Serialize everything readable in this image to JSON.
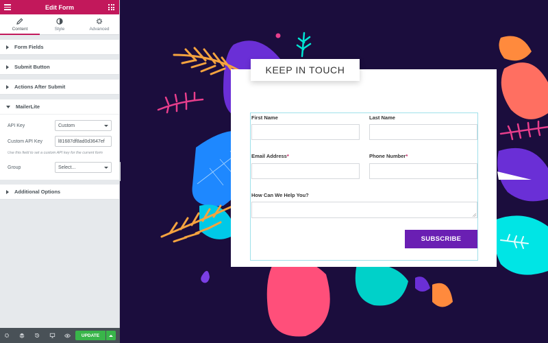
{
  "panel": {
    "title": "Edit Form",
    "tabs": [
      {
        "label": "Content",
        "icon": "pencil-icon",
        "active": true
      },
      {
        "label": "Style",
        "icon": "contrast-icon",
        "active": false
      },
      {
        "label": "Advanced",
        "icon": "gear-icon",
        "active": false
      }
    ],
    "sections": {
      "form_fields": "Form Fields",
      "submit_button": "Submit Button",
      "actions_after_submit": "Actions After Submit",
      "mailerlite": "MailerLite",
      "additional_options": "Additional Options"
    },
    "mailerlite": {
      "api_key_label": "API Key",
      "api_key_value": "Custom",
      "custom_api_key_label": "Custom API Key",
      "custom_api_key_value": "l81687df8ad0d3647ef",
      "hint": "Use this field to set a custom API key for the current form",
      "group_label": "Group",
      "group_value": "Select..."
    },
    "footer": {
      "icons": [
        "settings-icon",
        "layers-icon",
        "history-icon",
        "responsive-icon",
        "preview-icon"
      ],
      "update_label": "UPDATE"
    }
  },
  "colors": {
    "brand": "#c2185b",
    "canvas_bg": "#1b0d3d",
    "button": "#6a1fb3",
    "update": "#39b54a"
  },
  "form": {
    "heading": "KEEP IN TOUCH",
    "first_name_label": "First Name",
    "last_name_label": "Last Name",
    "email_label": "Email Address",
    "phone_label": "Phone Number",
    "required_marker": "*",
    "message_label": "How Can We Help You?",
    "submit_label": "SUBSCRIBE"
  }
}
